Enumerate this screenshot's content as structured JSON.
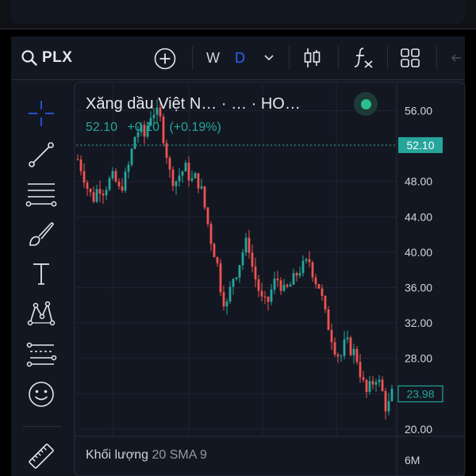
{
  "toolbar": {
    "symbol": "PLX",
    "timeframes": [
      "W",
      "D"
    ],
    "active_timeframe": "D",
    "icons": [
      "search-icon",
      "add-symbol-icon",
      "chevron-down-icon",
      "candles-icon",
      "indicators-fx-icon",
      "layout-grid-icon",
      "back-arrow-icon"
    ]
  },
  "drawing_tools": [
    "crosshair-icon",
    "trend-line-icon",
    "fib-retracement-icon",
    "brush-icon",
    "text-icon",
    "pattern-icon",
    "forecast-icon",
    "emoji-icon",
    "ruler-icon"
  ],
  "legend": {
    "title": "Xăng dầu Việt N… · … · HO…",
    "last": "52.10",
    "change": "+0.10",
    "change_pct": "(+0.19%)"
  },
  "price_axis": {
    "ticks": [
      "56.00",
      "52.00",
      "48.00",
      "44.00",
      "40.00",
      "36.00",
      "32.00",
      "28.00",
      "24.00",
      "20.00"
    ],
    "badges": [
      {
        "label": "52.10",
        "value": 52.1
      },
      {
        "label": "23.98",
        "value": 23.98
      }
    ]
  },
  "volume_pane": {
    "label": "Khối lượng",
    "params": "20 SMA 9",
    "axis_tick": "6M"
  },
  "colors": {
    "up": "#26a69a",
    "down": "#ef5350",
    "background": "#131722",
    "accent": "#2962ff",
    "badge_text": "#26a69a"
  },
  "chart_data": {
    "type": "candlestick",
    "ylim": [
      19.0,
      59.0
    ],
    "y_ticks": [
      56,
      52,
      48,
      44,
      40,
      36,
      32,
      28,
      24,
      20
    ],
    "last_price_line": 52.1,
    "trend_path_close": [
      50.5,
      49.0,
      47.0,
      46.0,
      47.5,
      47.0,
      48.0,
      48.5,
      47.0,
      48.0,
      50.0,
      53.0,
      54.0,
      53.0,
      55.5,
      56.0,
      55.0,
      52.0,
      48.5,
      48.0,
      49.0,
      49.5,
      48.0,
      48.5,
      47.0,
      44.0,
      41.0,
      39.0,
      35.0,
      34.0,
      37.0,
      38.0,
      40.0,
      41.5,
      38.0,
      36.0,
      34.0,
      34.5,
      36.5,
      37.0,
      35.5,
      36.0,
      37.0,
      38.0,
      38.5,
      39.0,
      37.0,
      36.0,
      33.0,
      31.0,
      29.0,
      28.0,
      30.0,
      29.0,
      28.5,
      26.0,
      24.0,
      25.0,
      26.0,
      24.5,
      22.0,
      23.98
    ]
  }
}
